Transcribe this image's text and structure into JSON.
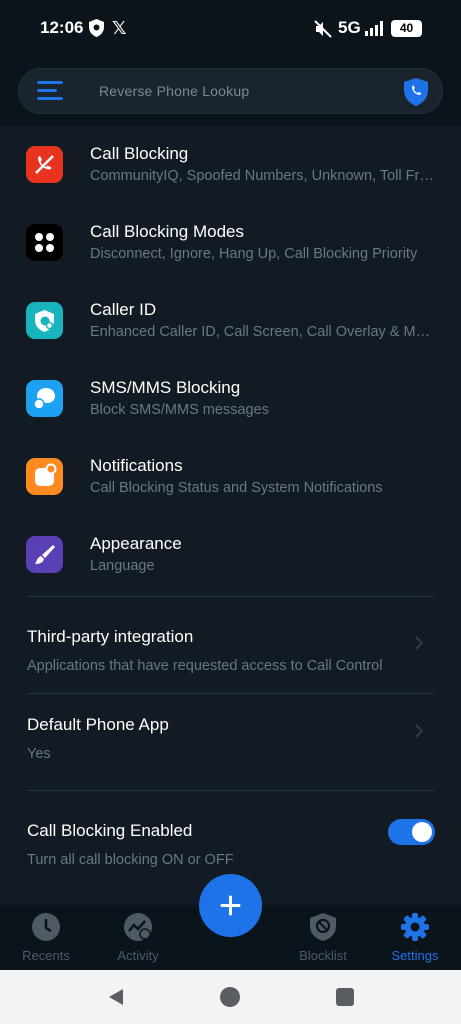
{
  "status_bar": {
    "time": "12:06",
    "x_glyph": "𝕏",
    "network": "5G",
    "battery": "40",
    "icons": [
      "shield-icon",
      "x-app-icon",
      "mute-icon",
      "signal-icon",
      "battery-icon"
    ]
  },
  "header": {
    "search_placeholder": "Reverse Phone Lookup",
    "menu_icon": "menu-icon",
    "shield_icon": "shield-call-icon",
    "accent": "#1e73e8"
  },
  "settings": [
    {
      "title": "Call Blocking",
      "subtitle": "CommunityIQ, Spoofed Numbers, Unknown, Toll Free, International",
      "icon": "blocked-phone-icon",
      "color": "#e8341e"
    },
    {
      "title": "Call Blocking Modes",
      "subtitle": "Disconnect, Ignore, Hang Up, Call Blocking Priority",
      "icon": "grid-dots-icon",
      "color": "#000000"
    },
    {
      "title": "Caller ID",
      "subtitle": "Enhanced Caller ID, Call Screen, Call Overlay & More",
      "icon": "caller-id-icon",
      "color": "#19b3bd"
    },
    {
      "title": "SMS/MMS Blocking",
      "subtitle": "Block SMS/MMS messages",
      "icon": "chat-bubble-icon",
      "color": "#1da1f2"
    },
    {
      "title": "Notifications",
      "subtitle": "Call Blocking Status and System Notifications",
      "icon": "notification-dot-icon",
      "color": "#ff8a1f"
    },
    {
      "title": "Appearance",
      "subtitle": "Language",
      "icon": "paintbrush-icon",
      "color": "#5b3fb5"
    }
  ],
  "sections": {
    "third_party": {
      "title": "Third-party integration",
      "subtitle": "Applications that have requested access to Call Control"
    },
    "default_phone": {
      "title": "Default Phone App",
      "subtitle": "Yes"
    },
    "call_blocking_enabled": {
      "title": "Call Blocking Enabled",
      "subtitle": "Turn all call blocking ON or OFF",
      "toggle_on": true
    }
  },
  "bottom_nav": {
    "items": [
      {
        "label": "Recents",
        "icon": "clock-icon",
        "active": false
      },
      {
        "label": "Activity",
        "icon": "activity-chart-icon",
        "active": false
      },
      {
        "label": "Blocklist",
        "icon": "block-shield-icon",
        "active": false
      },
      {
        "label": "Settings",
        "icon": "gear-icon",
        "active": true
      }
    ],
    "fab_icon": "plus-icon"
  },
  "android_nav": {
    "icons": [
      "back-icon",
      "home-icon",
      "recents-icon"
    ]
  }
}
